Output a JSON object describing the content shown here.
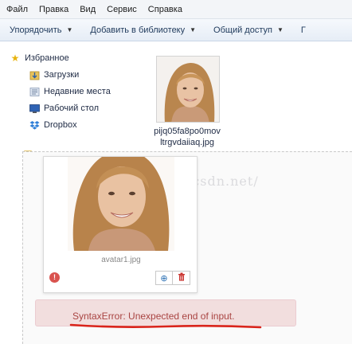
{
  "menubar": {
    "items": [
      "Файл",
      "Правка",
      "Вид",
      "Сервис",
      "Справка"
    ]
  },
  "toolbar": {
    "items": [
      "Упорядочить",
      "Добавить в библиотеку",
      "Общий доступ"
    ],
    "overflow": "Г"
  },
  "nav": {
    "favorites_label": "Избранное",
    "items": [
      {
        "label": "Загрузки",
        "icon": "downloads-icon"
      },
      {
        "label": "Недавние места",
        "icon": "recent-places-icon"
      },
      {
        "label": "Рабочий стол",
        "icon": "desktop-icon"
      },
      {
        "label": "Dropbox",
        "icon": "dropbox-icon"
      }
    ]
  },
  "file": {
    "name_line1": "pijq05fa8po0mov",
    "name_line2": "ltrgvdaiiaq.jpg"
  },
  "preview": {
    "caption": "avatar1.jpg",
    "error_message": "Unexpected end of input.",
    "error_type": "SyntaxError:",
    "watermark": "blog.csdn.net/"
  },
  "colors": {
    "error_bg": "#f2dede",
    "error_text": "#a94442",
    "underline": "#d9241b"
  }
}
